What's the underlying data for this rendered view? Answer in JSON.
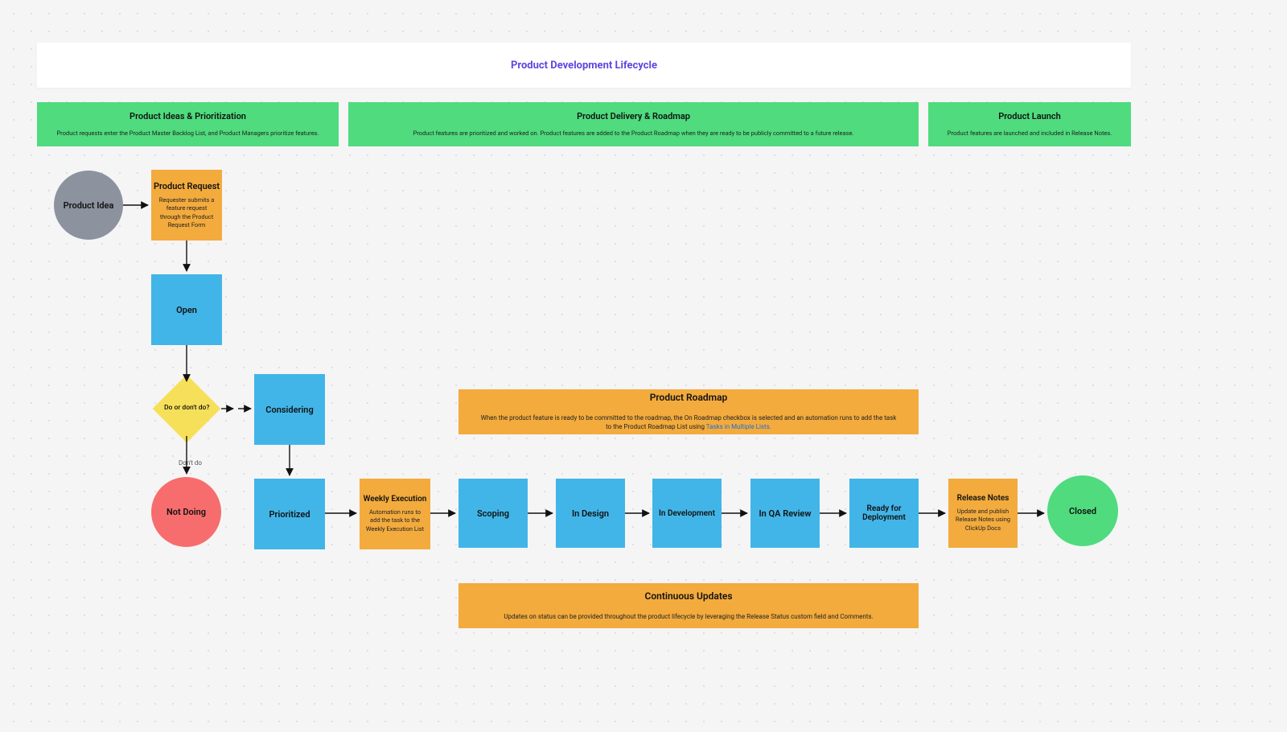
{
  "title": "Product Development Lifecycle",
  "phases": {
    "ideas": {
      "title": "Product Ideas & Prioritization",
      "sub": "Product requests enter the Product Master Backlog List, and Product Managers prioritize features."
    },
    "delivery": {
      "title": "Product Delivery & Roadmap",
      "sub": "Product features are prioritized and worked on. Product features are added to the Product Roadmap when they are ready to be publicly committed to a future release."
    },
    "launch": {
      "title": "Product Launch",
      "sub": "Product features are launched and included in Release Notes."
    }
  },
  "nodes": {
    "idea": {
      "title": "Product Idea"
    },
    "request": {
      "title": "Product Request",
      "sub": "Requester submits a feature request through the Product Request Form"
    },
    "open": {
      "title": "Open"
    },
    "decision": {
      "title": "Do or don't do?"
    },
    "considering": {
      "title": "Considering"
    },
    "notdoing": {
      "title": "Not Doing"
    },
    "prioritized": {
      "title": "Prioritized"
    },
    "weekly": {
      "title": "Weekly Execution",
      "sub": "Automation runs to add the task to the Weekly Execution List"
    },
    "scoping": {
      "title": "Scoping"
    },
    "indesign": {
      "title": "In Design"
    },
    "indev": {
      "title": "In Development"
    },
    "inqa": {
      "title": "In QA Review"
    },
    "readydep": {
      "title": "Ready for Deployment"
    },
    "relnotes": {
      "title": "Release Notes",
      "sub": "Update and publish Release Notes using ClickUp Docs"
    },
    "closed": {
      "title": "Closed"
    },
    "roadmap": {
      "title": "Product Roadmap",
      "sub": "When the product feature is ready to be committed to the roadmap, the On Roadmap checkbox is selected and an automation runs to add the task to the Product Roadmap List using ",
      "link": "Tasks in Multiple Lists."
    },
    "updates": {
      "title": "Continuous Updates",
      "sub": "Updates on status can be provided throughout the product lifecycle by leveraging the Release Status custom field and Comments."
    }
  },
  "labels": {
    "dontdo": "Don't do"
  }
}
